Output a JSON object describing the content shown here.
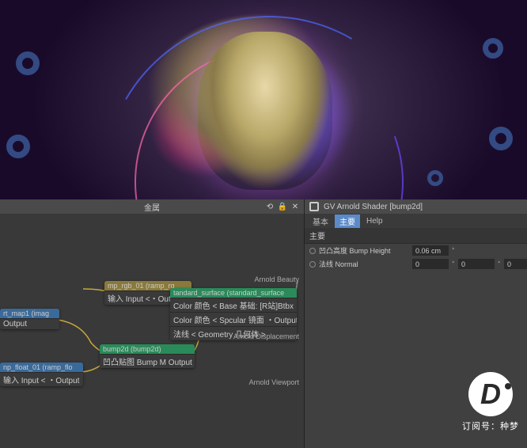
{
  "node_editor": {
    "title": "金属",
    "nodes": {
      "ramp_rgb": {
        "title": "mp_rgb_01 (ramp_rg",
        "row": "输入 Input <・Output"
      },
      "rt_map": {
        "title": "rt_map1 (imag",
        "row": "Output"
      },
      "ramp_float": {
        "title": "np_float_01 (ramp_flo",
        "row": "输入 Input < ・Output"
      },
      "bump2d": {
        "title": "bump2d (bump2d)",
        "row": "凹凸贴图 Bump M Output"
      },
      "standard_surface": {
        "title": "tandard_surface (standard_surface",
        "row1": "Color 颜色 < Base 基础: [R站]Btbx",
        "row2": "Color 颜色 < Spcular 镜面 ・Output",
        "row3": "法线 < Geometry 几何体 >"
      }
    },
    "outputs": {
      "beauty": "Arnold Beauty",
      "displacement": "Arnold Displacement",
      "viewport": "Arnold Viewport"
    }
  },
  "properties": {
    "title": "GV Arnold Shader [bump2d]",
    "tabs": {
      "t0": "基本",
      "t1": "主要",
      "t2": "Help"
    },
    "section": "主要",
    "rows": {
      "bump_height": {
        "label": "凹凸高度 Bump Height",
        "value": "0.06 cm"
      },
      "normal": {
        "label": "法线 Normal",
        "v0": "0",
        "v1": "0",
        "v2": "0"
      }
    }
  },
  "watermark": {
    "logo": "D",
    "text": "订阅号：种梦"
  }
}
